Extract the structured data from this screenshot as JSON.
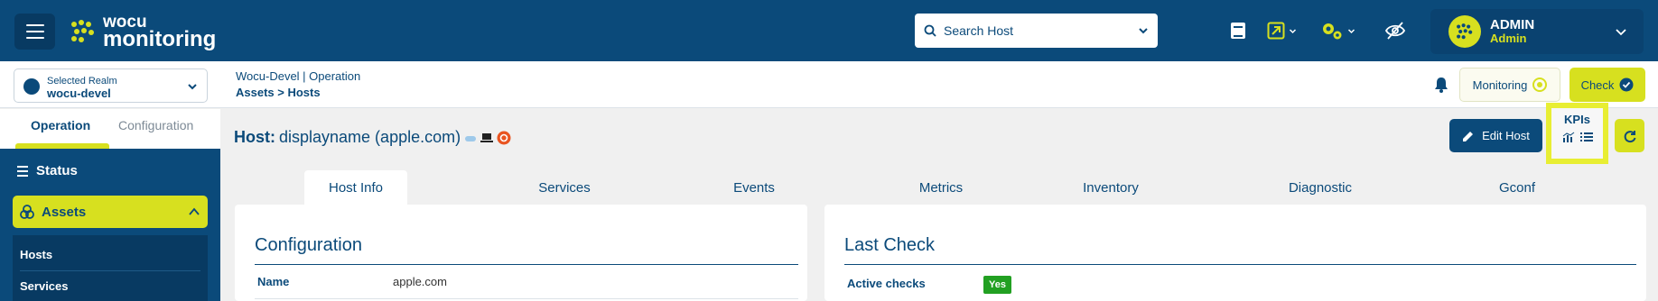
{
  "header": {
    "logo": {
      "line1": "wocu",
      "line2": "monitoring"
    },
    "search": {
      "placeholder": "Search Host"
    },
    "user": {
      "name": "ADMIN",
      "role": "Admin"
    }
  },
  "subheader": {
    "realm": {
      "label": "Selected Realm",
      "value": "wocu-devel"
    },
    "breadcrumb": {
      "line1": "Wocu-Devel | Operation",
      "line2": "Assets > Hosts"
    },
    "monitoring_label": "Monitoring",
    "check_label": "Check"
  },
  "sidebar": {
    "tabs": [
      {
        "label": "Operation"
      },
      {
        "label": "Configuration"
      }
    ],
    "status_label": "Status",
    "assets_label": "Assets",
    "sub_items": [
      {
        "label": "Hosts"
      },
      {
        "label": "Services"
      }
    ]
  },
  "main": {
    "host_prefix": "Host:",
    "host_name": "displayname (apple.com)",
    "edit_label": "Edit Host",
    "kpis_label": "KPIs",
    "tabs": [
      {
        "label": "Host Info"
      },
      {
        "label": "Services"
      },
      {
        "label": "Events"
      },
      {
        "label": "Metrics"
      },
      {
        "label": "Inventory"
      },
      {
        "label": "Diagnostic"
      },
      {
        "label": "Gconf"
      }
    ],
    "configuration": {
      "title": "Configuration",
      "rows": [
        {
          "key": "Name",
          "value": "apple.com"
        }
      ]
    },
    "last_check": {
      "title": "Last Check",
      "rows": [
        {
          "key": "Active checks",
          "value": "Yes"
        }
      ]
    }
  },
  "colors": {
    "primary": "#0b4a7a",
    "accent": "#d7e01f",
    "success": "#22a022"
  }
}
